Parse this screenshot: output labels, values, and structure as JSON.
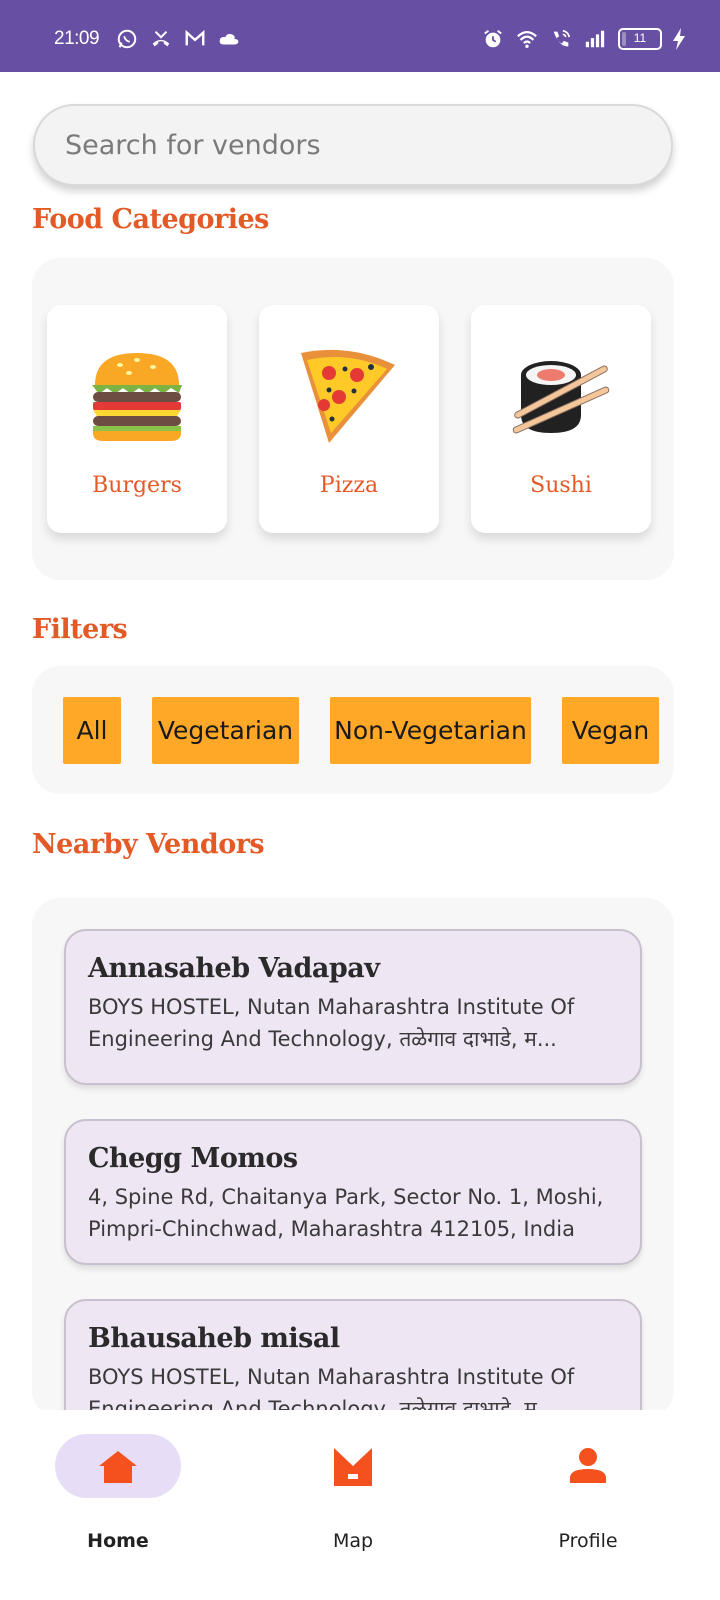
{
  "status_bar": {
    "time": "21:09",
    "battery_level": "11",
    "background_color": "#6750A4",
    "left_icons": [
      "whatsapp-icon",
      "missed-call-icon",
      "gmail-icon",
      "cloud-icon"
    ],
    "right_icons": [
      "alarm-icon",
      "wifi-icon",
      "wifi-calling-icon",
      "signal-icon",
      "battery-icon",
      "charging-icon"
    ]
  },
  "search": {
    "placeholder": "Search for vendors"
  },
  "sections": {
    "categories_title": "Food Categories",
    "filters_title": "Filters",
    "vendors_title": "Nearby Vendors"
  },
  "categories": [
    {
      "label": "Burgers",
      "icon": "burger-icon"
    },
    {
      "label": "Pizza",
      "icon": "pizza-icon"
    },
    {
      "label": "Sushi",
      "icon": "sushi-icon"
    }
  ],
  "filters": [
    "All",
    "Vegetarian",
    "Non-Vegetarian",
    "Vegan"
  ],
  "vendors": [
    {
      "name": "Annasaheb Vadapav",
      "address": "BOYS HOSTEL, Nutan Maharashtra Institute Of Engineering And Technology, तळेगाव दाभाडे, म..."
    },
    {
      "name": "Chegg Momos",
      "address": "4, Spine Rd, Chaitanya Park, Sector No. 1, Moshi, Pimpri-Chinchwad, Maharashtra 412105, India"
    },
    {
      "name": "Bhausaheb misal",
      "address": "BOYS HOSTEL, Nutan Maharashtra Institute Of Engineering And Technology, तळेगाव दाभाडे, म..."
    }
  ],
  "nav": [
    {
      "label": "Home",
      "icon": "home-icon",
      "active": true
    },
    {
      "label": "Map",
      "icon": "map-icon",
      "active": false
    },
    {
      "label": "Profile",
      "icon": "profile-icon",
      "active": false
    }
  ],
  "colors": {
    "accent": "#e45a27",
    "chip": "#ffa726",
    "card": "#efe6f4",
    "nav_active_pill": "#e8ddf7"
  }
}
